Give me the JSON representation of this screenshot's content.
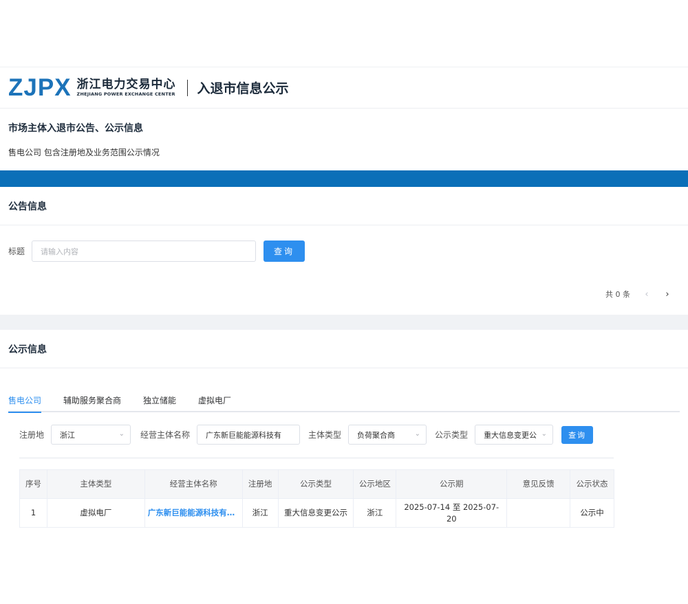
{
  "header": {
    "logo_mark": "ZJPX",
    "logo_cn": "浙江电力交易中心",
    "logo_en": "ZHEJIANG POWER EXCHANGE CENTER",
    "page_title": "入退市信息公示"
  },
  "intro": {
    "title": "市场主体入退市公告、公示信息",
    "desc": "售电公司 包含注册地及业务范围公示情况"
  },
  "announcement": {
    "section_title": "公告信息",
    "title_label": "标题",
    "title_placeholder": "请输入内容",
    "search_button": "查询",
    "total_text": "共 0 条",
    "prev_icon": "‹",
    "next_icon": "›"
  },
  "publicity": {
    "section_title": "公示信息",
    "tabs": [
      {
        "label": "售电公司",
        "active": true
      },
      {
        "label": "辅助服务聚合商",
        "active": false
      },
      {
        "label": "独立储能",
        "active": false
      },
      {
        "label": "虚拟电厂",
        "active": false
      }
    ],
    "filters": {
      "region_label": "注册地",
      "region_value": "浙江",
      "entity_label": "经营主体名称",
      "entity_value": "广东新巨能能源科技有",
      "type_label": "主体类型",
      "type_value": "负荷聚合商",
      "notice_type_label": "公示类型",
      "notice_type_value": "重大信息变更公",
      "search_button": "查询"
    },
    "table": {
      "headers": [
        "序号",
        "主体类型",
        "经营主体名称",
        "注册地",
        "公示类型",
        "公示地区",
        "公示期",
        "意见反馈",
        "公示状态"
      ],
      "rows": [
        [
          "1",
          "虚拟电厂",
          "广东新巨能能源科技有限公司",
          "浙江",
          "重大信息变更公示",
          "浙江",
          "2025-07-14 至 2025-07-20",
          "",
          "公示中"
        ]
      ]
    }
  },
  "colors": {
    "brand_blue": "#1c73b9",
    "band_blue": "#0b6fb8",
    "primary": "#2e8fef"
  }
}
